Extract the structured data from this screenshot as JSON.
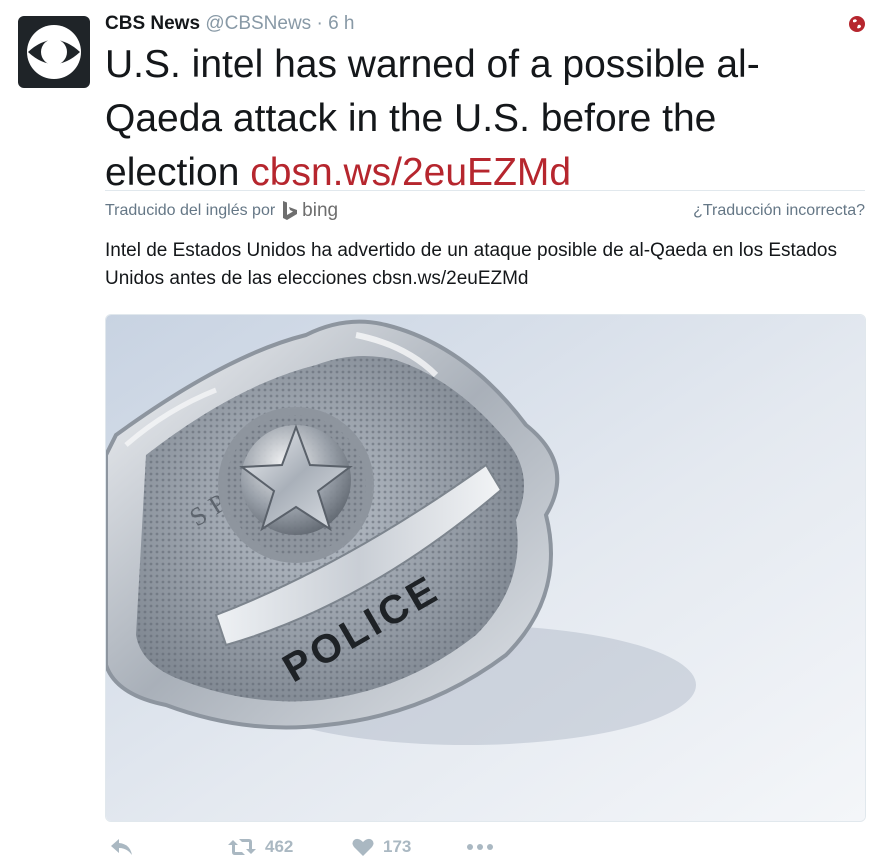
{
  "tweet": {
    "author_name": "CBS News",
    "handle": "@CBSNews",
    "separator": "·",
    "time": "6 h",
    "text_main": "U.S. intel has warned of a possible al-Qaeda attack in the U.S. before the election ",
    "text_link": "cbsn.ws/2euEZMd",
    "link_color": "#b6262e"
  },
  "translation_bar": {
    "translated_by": "Traducido del inglés por",
    "provider": "bing",
    "wrong_translation": "¿Traducción incorrecta?"
  },
  "translation": {
    "text": "Intel de Estados Unidos ha advertido de un ataque posible de al-Qaeda en los Estados Unidos antes de las elecciones cbsn.ws/2euEZMd"
  },
  "media": {
    "badge_top_text": "SPECIAL",
    "badge_ribbon_text": "POLICE"
  },
  "actions": {
    "reply_icon": "reply-icon",
    "retweet_icon": "retweet-icon",
    "retweet_count": "462",
    "like_icon": "heart-icon",
    "like_count": "173",
    "more_icon": "more-icon"
  },
  "colors": {
    "accent": "#b6262e",
    "muted": "#8899a6",
    "action_gray": "#aab8c2"
  }
}
